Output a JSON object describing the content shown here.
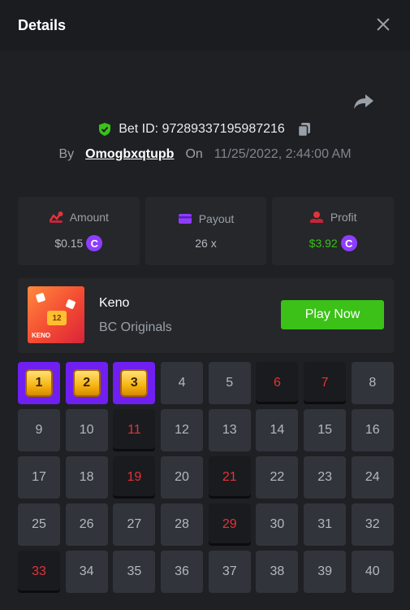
{
  "header": {
    "title": "Details"
  },
  "bet": {
    "bet_id_text": "Bet ID: 97289337195987216",
    "by_label": "By",
    "username": "Omogbxqtupb",
    "on_label": "On",
    "datetime": "11/25/2022, 2:44:00 AM"
  },
  "stats": [
    {
      "label": "Amount",
      "value": "$0.15",
      "has_coin": true,
      "icon": "amount-icon"
    },
    {
      "label": "Payout",
      "value": "26 x",
      "has_coin": false,
      "icon": "payout-icon"
    },
    {
      "label": "Profit",
      "value": "$3.92",
      "has_coin": true,
      "icon": "profit-icon"
    }
  ],
  "coin_symbol": "C",
  "game": {
    "name": "Keno",
    "provider": "BC Originals",
    "play_label": "Play Now",
    "thumb_number": "12",
    "thumb_tag": "KENO"
  },
  "board": {
    "numbers": [
      "1",
      "2",
      "3",
      "4",
      "5",
      "6",
      "7",
      "8",
      "9",
      "10",
      "11",
      "12",
      "13",
      "14",
      "15",
      "16",
      "17",
      "18",
      "19",
      "20",
      "21",
      "22",
      "23",
      "24",
      "25",
      "26",
      "27",
      "28",
      "29",
      "30",
      "31",
      "32",
      "33",
      "34",
      "35",
      "36",
      "37",
      "38",
      "39",
      "40"
    ],
    "hits": [
      1,
      2,
      3
    ],
    "drawn_misses": [
      6,
      7,
      11,
      19,
      21,
      29,
      33
    ]
  },
  "colors": {
    "accent_green": "#3bc117",
    "hit_purple": "#6f1ff0",
    "drawn_red": "#e5323a",
    "coin_purple": "#8e3dfe",
    "background": "#1e2024"
  }
}
